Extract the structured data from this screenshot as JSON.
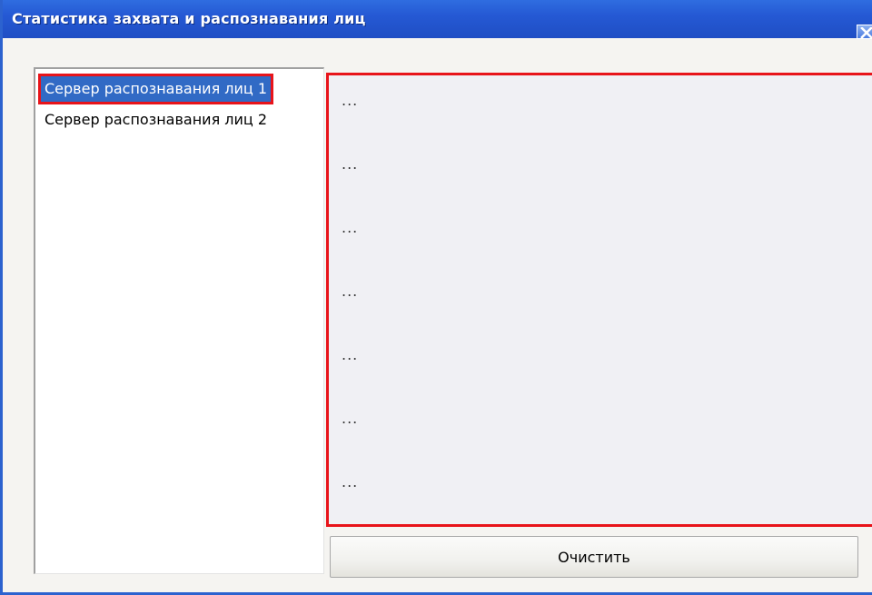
{
  "window": {
    "title": "Статистика захвата и распознавания лиц"
  },
  "server_list": {
    "items": [
      {
        "label": "Сервер распознавания лиц 1",
        "selected": true
      },
      {
        "label": "Сервер распознавания лиц 2",
        "selected": false
      }
    ]
  },
  "stats_panel": {
    "lines": [
      "...",
      "...",
      "...",
      "...",
      "...",
      "...",
      "..."
    ]
  },
  "buttons": {
    "clear_label": "Очистить"
  },
  "colors": {
    "titlebar": "#2559d4",
    "selection": "#316ac5",
    "highlight_outline": "#e8141a",
    "panel_bg": "#f0f0f4"
  },
  "icons": {
    "close": "close-icon"
  }
}
